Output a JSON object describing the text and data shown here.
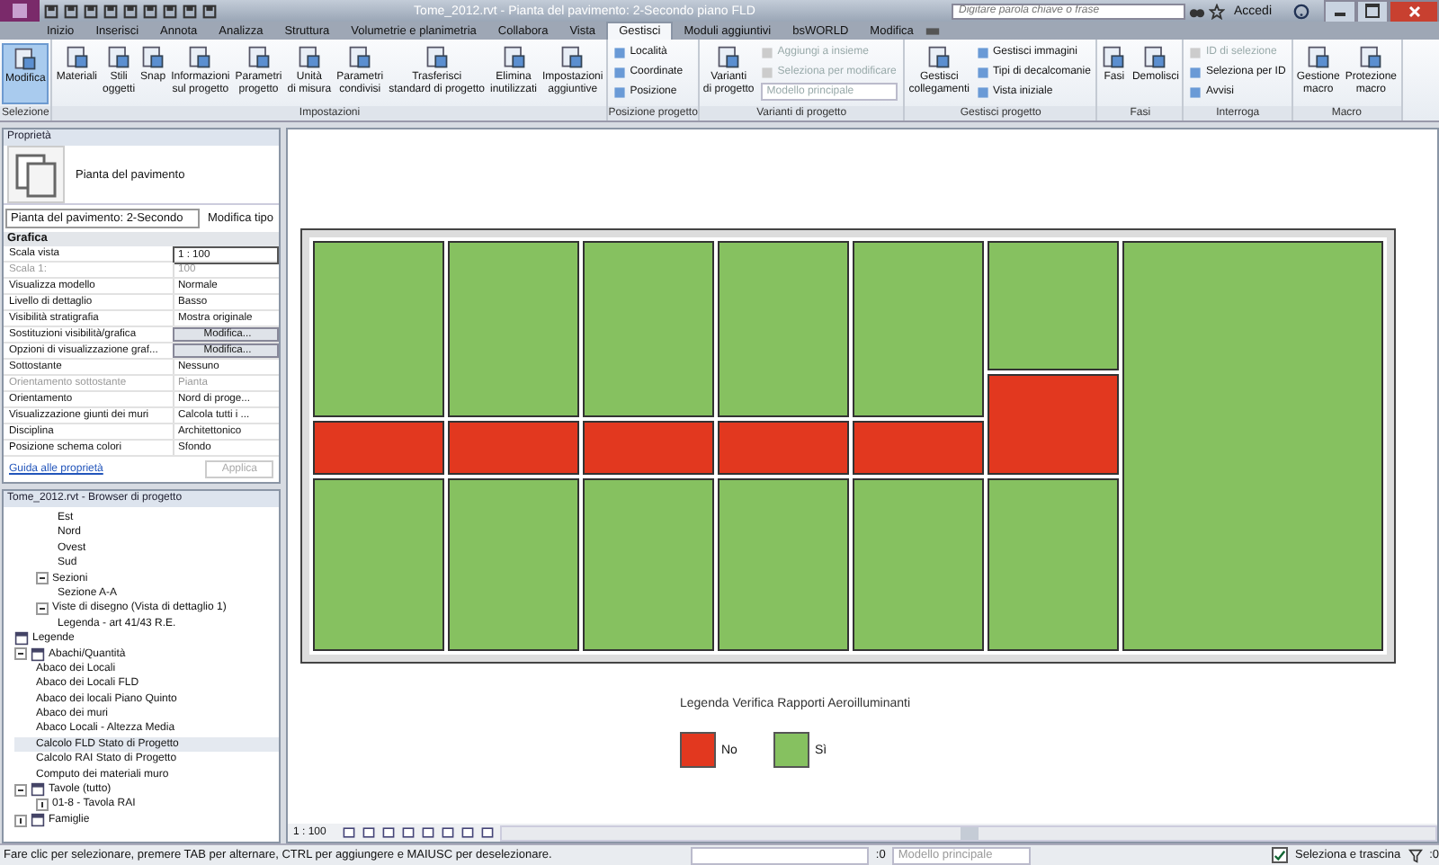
{
  "window": {
    "title": "Tome_2012.rvt - Pianta del pavimento: 2-Secondo piano FLD"
  },
  "search": {
    "placeholder": "Digitare parola chiave o frase"
  },
  "account": {
    "label": "Accedi"
  },
  "tabs": [
    {
      "label": "Inizio",
      "selected": false
    },
    {
      "label": "Inserisci",
      "selected": false
    },
    {
      "label": "Annota",
      "selected": false
    },
    {
      "label": "Analizza",
      "selected": false
    },
    {
      "label": "Struttura",
      "selected": false
    },
    {
      "label": "Volumetrie e planimetria",
      "selected": false
    },
    {
      "label": "Collabora",
      "selected": false
    },
    {
      "label": "Vista",
      "selected": false
    },
    {
      "label": "Gestisci",
      "selected": true
    },
    {
      "label": "Moduli aggiuntivi",
      "selected": false
    },
    {
      "label": "bsWORLD",
      "selected": false
    },
    {
      "label": "Modifica",
      "selected": false
    }
  ],
  "ribbon": [
    {
      "label": "Selezione",
      "items": [
        {
          "kind": "large",
          "label": "Modifica",
          "selected": true
        }
      ]
    },
    {
      "label": "Impostazioni",
      "items": [
        {
          "kind": "large",
          "label": "Materiali",
          "selected": false
        },
        {
          "kind": "large",
          "label": "Stili\noggetti",
          "selected": false
        },
        {
          "kind": "large",
          "label": "Snap",
          "selected": false
        },
        {
          "kind": "large",
          "label": "Informazioni\nsul progetto",
          "selected": false
        },
        {
          "kind": "large",
          "label": "Parametri\nprogetto",
          "selected": false
        },
        {
          "kind": "large",
          "label": "Unità\ndi misura",
          "selected": false
        },
        {
          "kind": "large",
          "label": "Parametri\ncondivisi",
          "selected": false
        },
        {
          "kind": "large",
          "label": "Trasferisci\nstandard di progetto",
          "selected": false
        },
        {
          "kind": "large",
          "label": "Elimina\ninutilizzati",
          "selected": false
        },
        {
          "kind": "large",
          "label": "Impostazioni\naggiuntive",
          "selected": false
        }
      ]
    },
    {
      "label": "Posizione progetto",
      "items": [
        {
          "kind": "stack",
          "items": [
            {
              "kind": "small",
              "label": "Località",
              "disabled": false
            },
            {
              "kind": "small",
              "label": "Coordinate",
              "disabled": false
            },
            {
              "kind": "small",
              "label": "Posizione",
              "disabled": false
            }
          ]
        }
      ]
    },
    {
      "label": "Varianti di progetto",
      "items": [
        {
          "kind": "large",
          "label": "Varianti\ndi progetto",
          "selected": false
        },
        {
          "kind": "stack",
          "items": [
            {
              "kind": "small",
              "label": "Aggiungi a insieme",
              "disabled": true
            },
            {
              "kind": "small",
              "label": "Seleziona per modificare",
              "disabled": true
            },
            {
              "kind": "dropdown",
              "label": "Modello principale",
              "disabled": true
            }
          ]
        }
      ]
    },
    {
      "label": "Gestisci progetto",
      "items": [
        {
          "kind": "large",
          "label": "Gestisci\ncollegamenti",
          "selected": false
        },
        {
          "kind": "stack",
          "items": [
            {
              "kind": "small",
              "label": "Gestisci immagini",
              "disabled": false
            },
            {
              "kind": "small",
              "label": "Tipi di decalcomanie",
              "disabled": false
            },
            {
              "kind": "small",
              "label": "Vista iniziale",
              "disabled": false
            }
          ]
        }
      ]
    },
    {
      "label": "Fasi",
      "items": [
        {
          "kind": "large",
          "label": "Fasi",
          "selected": false
        },
        {
          "kind": "large",
          "label": "Demolisci",
          "selected": false
        }
      ]
    },
    {
      "label": "Interroga",
      "items": [
        {
          "kind": "stack",
          "items": [
            {
              "kind": "small",
              "label": "ID di selezione",
              "disabled": true
            },
            {
              "kind": "small",
              "label": "Seleziona per ID",
              "disabled": false
            },
            {
              "kind": "small",
              "label": "Avvisi",
              "disabled": false
            }
          ]
        }
      ]
    },
    {
      "label": "Macro",
      "items": [
        {
          "kind": "large",
          "label": "Gestione\nmacro",
          "selected": false
        },
        {
          "kind": "large",
          "label": "Protezione\nmacro",
          "selected": false
        }
      ]
    }
  ],
  "properties": {
    "title": "Proprietà",
    "type_name": "Pianta del pavimento",
    "instance": "Pianta del pavimento: 2-Secondo",
    "edit_type": "Modifica tipo",
    "group": "Grafica",
    "rows": [
      {
        "label": "Scala vista",
        "value": "1 : 100",
        "kind": "input",
        "disabled": false
      },
      {
        "label": "Scala 1:",
        "value": "100",
        "kind": "text",
        "disabled": true
      },
      {
        "label": "Visualizza modello",
        "value": "Normale",
        "kind": "text",
        "disabled": false
      },
      {
        "label": "Livello di dettaglio",
        "value": "Basso",
        "kind": "text",
        "disabled": false
      },
      {
        "label": "Visibilità stratigrafia",
        "value": "Mostra originale",
        "kind": "text",
        "disabled": false
      },
      {
        "label": "Sostituzioni visibilità/grafica",
        "value": "Modifica...",
        "kind": "button",
        "disabled": false
      },
      {
        "label": "Opzioni di visualizzazione graf...",
        "value": "Modifica...",
        "kind": "button",
        "disabled": false
      },
      {
        "label": "Sottostante",
        "value": "Nessuno",
        "kind": "text",
        "disabled": false
      },
      {
        "label": "Orientamento sottostante",
        "value": "Pianta",
        "kind": "text",
        "disabled": true
      },
      {
        "label": "Orientamento",
        "value": "Nord di proge...",
        "kind": "text",
        "disabled": false
      },
      {
        "label": "Visualizzazione giunti dei muri",
        "value": "Calcola tutti i ...",
        "kind": "text",
        "disabled": false
      },
      {
        "label": "Disciplina",
        "value": "Architettonico",
        "kind": "text",
        "disabled": false
      },
      {
        "label": "Posizione schema colori",
        "value": "Sfondo",
        "kind": "text",
        "disabled": false
      }
    ],
    "help": "Guida alle proprietà",
    "apply": "Applica"
  },
  "browser": {
    "title": "Tome_2012.rvt - Browser di progetto",
    "items": [
      {
        "children": [
          {
            "children": [
              {
                "label": "Est",
                "selected": false
              },
              {
                "label": "Nord",
                "selected": false
              },
              {
                "label": "Ovest",
                "selected": false
              },
              {
                "label": "Sud",
                "selected": false
              }
            ]
          },
          {
            "label": "Sezioni",
            "selected": false,
            "expanded": true,
            "children": [
              {
                "label": "Sezione A-A",
                "selected": false
              }
            ]
          },
          {
            "label": "Viste di disegno (Vista di dettaglio 1)",
            "selected": false,
            "expanded": true,
            "children": [
              {
                "label": "Legenda - art 41/43 R.E.",
                "selected": false
              }
            ]
          }
        ]
      },
      {
        "label": "Legende",
        "selected": false
      },
      {
        "label": "Abachi/Quantità",
        "selected": false,
        "expanded": true,
        "children": [
          {
            "label": "Abaco dei Locali",
            "selected": false
          },
          {
            "label": "Abaco dei Locali FLD",
            "selected": false
          },
          {
            "label": "Abaco dei locali Piano Quinto",
            "selected": false
          },
          {
            "label": "Abaco dei muri",
            "selected": false
          },
          {
            "label": "Abaco Locali - Altezza Media",
            "selected": false
          },
          {
            "label": "Calcolo FLD Stato di Progetto",
            "selected": true
          },
          {
            "label": "Calcolo RAI Stato di Progetto",
            "selected": false
          },
          {
            "label": "Computo dei materiali muro",
            "selected": false
          }
        ]
      },
      {
        "label": "Tavole (tutto)",
        "selected": false,
        "expanded": true,
        "children": [
          {
            "label": "01-8 - Tavola RAI",
            "selected": false,
            "expanded": false
          }
        ]
      },
      {
        "label": "Famiglie",
        "selected": false,
        "expanded": false
      }
    ]
  },
  "plan": {
    "top_rooms": [
      {
        "color": "#86c160"
      },
      {
        "color": "#86c160"
      },
      {
        "color": "#86c160"
      },
      {
        "color": "#86c160"
      },
      {
        "color": "#86c160"
      },
      {
        "color": "#86c160"
      }
    ],
    "corridor_rooms": [
      {
        "color": "#e2381f"
      },
      {
        "color": "#e2381f"
      },
      {
        "color": "#e2381f"
      },
      {
        "color": "#e2381f"
      },
      {
        "color": "#e2381f"
      },
      {
        "color": "#e2381f"
      }
    ],
    "bottom_rooms": [
      {
        "color": "#86c160"
      },
      {
        "color": "#86c160"
      },
      {
        "color": "#86c160"
      },
      {
        "color": "#86c160"
      },
      {
        "color": "#86c160"
      },
      {
        "color": "#86c160"
      }
    ],
    "large_room": {
      "color": "#86c160"
    },
    "legend": {
      "title": "Legenda Verifica Rapporti Aeroilluminanti",
      "items": [
        {
          "label": "No",
          "color": "#e2381f"
        },
        {
          "label": "Sì",
          "color": "#86c160"
        }
      ]
    }
  },
  "view_bar": {
    "scale": "1 : 100"
  },
  "status_bar": {
    "message": "Fare clic per selezionare, premere TAB per alternare, CTRL per aggiungere e MAIUSC per deselezionare.",
    "count": ":0",
    "model": "Modello principale",
    "drag_label": "Seleziona e trascina",
    "drag_checked": true,
    "filter_count": ":0"
  }
}
